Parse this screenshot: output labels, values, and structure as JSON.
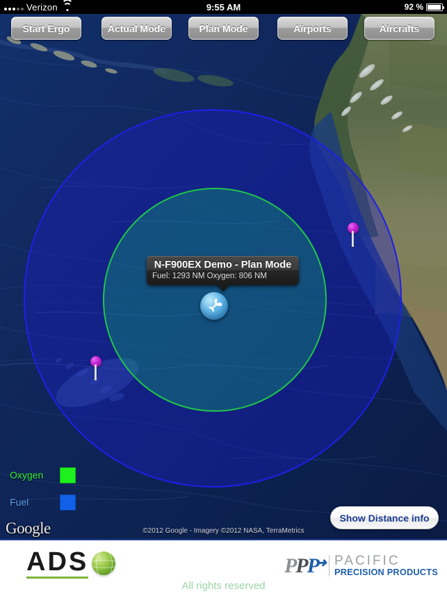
{
  "status_bar": {
    "carrier": "Verizon",
    "signal_icon": "signal-bars-icon",
    "wifi_icon": "wifi-icon",
    "time": "9:55 AM",
    "battery_percent": "92 %",
    "battery_icon": "battery-icon"
  },
  "toolbar": {
    "buttons": [
      {
        "label": "Start Ergo",
        "name": "start-ergo-button"
      },
      {
        "label": "Actual Mode",
        "name": "actual-mode-button"
      },
      {
        "label": "Plan Mode",
        "name": "plan-mode-button"
      },
      {
        "label": "Airports",
        "name": "airports-button"
      },
      {
        "label": "Aircrafts",
        "name": "aircrafts-button"
      }
    ]
  },
  "map": {
    "type": "satellite",
    "aircraft_icon": "airplane-icon",
    "callout": {
      "title": "N-F900EX Demo - Plan Mode",
      "subtitle": "Fuel: 1293 NM Oxygen: 806 NM",
      "fuel_range_nm": 1293,
      "oxygen_range_nm": 806
    },
    "rings": [
      {
        "name": "fuel-range-circle",
        "label": "Fuel",
        "color": "#1f1fe6",
        "fill": "rgba(26,26,220,0.34)"
      },
      {
        "name": "oxygen-range-circle",
        "label": "Oxygen",
        "color": "#1ec64a",
        "fill": "rgba(20,190,110,0.30)"
      }
    ],
    "pins": [
      {
        "name": "map-pin-hawaii",
        "icon": "map-pin-icon",
        "color": "#c11fd0"
      },
      {
        "name": "map-pin-westcoast",
        "icon": "map-pin-icon",
        "color": "#c11fd0"
      }
    ],
    "legend": [
      {
        "label": "Oxygen",
        "color": "#1ef01e",
        "text_color": "#35f135"
      },
      {
        "label": "Fuel",
        "color": "#1161e8",
        "text_color": "#5ea3f5"
      }
    ],
    "google_logo": "Google",
    "attribution": "©2012 Google - Imagery ©2012 NASA, TerraMetrics",
    "distance_button": "Show Distance info"
  },
  "footer": {
    "ads_logo_text": "ADS",
    "ads_globe_icon": "globe-icon",
    "ppp_mark": {
      "p1": "P",
      "p2": "P",
      "p3": "P",
      "arrow": "➜"
    },
    "ppp_pacific": "PACIFIC",
    "ppp_precision": "PRECISION PRODUCTS",
    "rights": "All rights reserved"
  }
}
